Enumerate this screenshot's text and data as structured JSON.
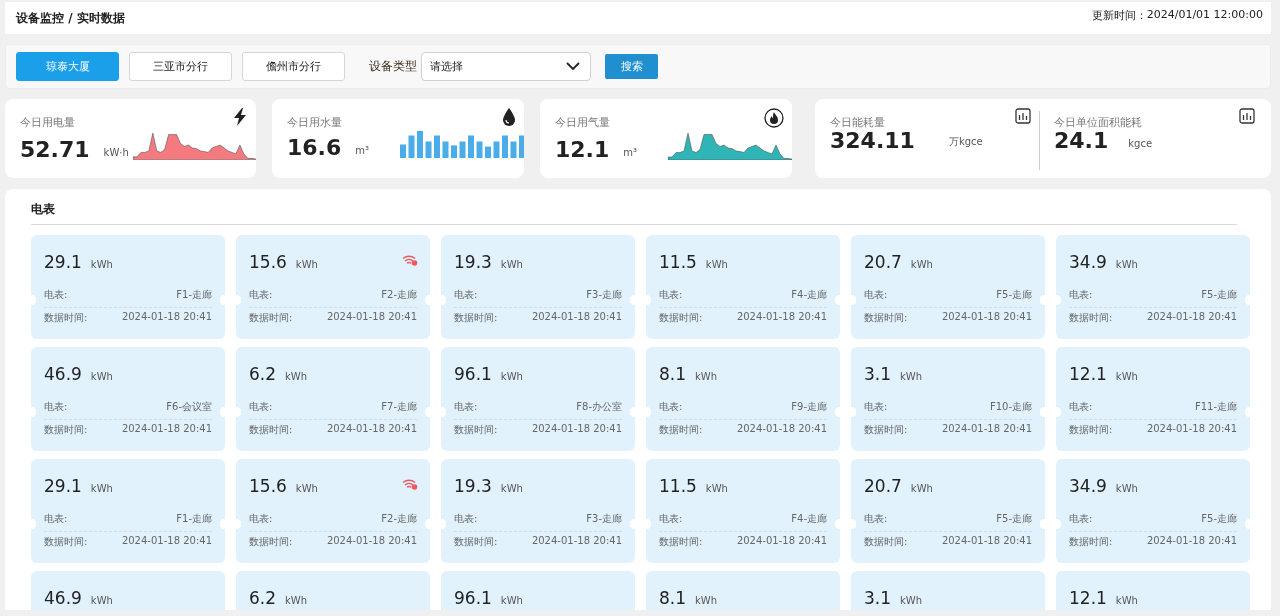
{
  "header": {
    "breadcrumb": "设备监控 / 实时数据",
    "update_label": "更新时间：",
    "update_time": "2024/01/01 12:00:00"
  },
  "filters": {
    "sites": [
      {
        "label": "琼泰大厦",
        "selected": true
      },
      {
        "label": "三亚市分行",
        "selected": false
      },
      {
        "label": "儋州市分行",
        "selected": false
      }
    ],
    "device_type_label": "设备类型",
    "device_type": {
      "placeholder": "请选择"
    },
    "search_button": "搜索"
  },
  "stats": [
    {
      "title": "今日用电量",
      "value": "52.71",
      "unit": "kW·h",
      "kind": "power",
      "color": "#f47a80"
    },
    {
      "title": "今日用水量",
      "value": "16.6",
      "unit": "m³",
      "kind": "water",
      "color": "#4aade8"
    },
    {
      "title": "今日用气量",
      "value": "12.1",
      "unit": "m³",
      "kind": "gas",
      "color": "#2fb5b5"
    }
  ],
  "energy": [
    {
      "title": "今日能耗量",
      "value": "324.11",
      "unit": "万kgce"
    },
    {
      "title": "今日单位面积能耗",
      "value": "24.1",
      "unit": "kgce"
    }
  ],
  "meters": {
    "title": "电表",
    "cards": [
      {
        "value": "29.1",
        "unit": "kWh",
        "offline": false,
        "meter_label": "电表:",
        "meter": "F1-走廊",
        "time_label": "数据时间:",
        "time": "2024-01-18 20:41"
      },
      {
        "value": "15.6",
        "unit": "kWh",
        "offline": true,
        "meter_label": "电表:",
        "meter": "F2-走廊",
        "time_label": "数据时间:",
        "time": "2024-01-18 20:41"
      },
      {
        "value": "19.3",
        "unit": "kWh",
        "offline": false,
        "meter_label": "电表:",
        "meter": "F3-走廊",
        "time_label": "数据时间:",
        "time": "2024-01-18 20:41"
      },
      {
        "value": "11.5",
        "unit": "kWh",
        "offline": false,
        "meter_label": "电表:",
        "meter": "F4-走廊",
        "time_label": "数据时间:",
        "time": "2024-01-18 20:41"
      },
      {
        "value": "20.7",
        "unit": "kWh",
        "offline": false,
        "meter_label": "电表:",
        "meter": "F5-走廊",
        "time_label": "数据时间:",
        "time": "2024-01-18 20:41"
      },
      {
        "value": "34.9",
        "unit": "kWh",
        "offline": false,
        "meter_label": "电表:",
        "meter": "F5-走廊",
        "time_label": "数据时间:",
        "time": "2024-01-18 20:41"
      },
      {
        "value": "46.9",
        "unit": "kWh",
        "offline": false,
        "meter_label": "电表:",
        "meter": "F6-会议室",
        "time_label": "数据时间:",
        "time": "2024-01-18 20:41"
      },
      {
        "value": "6.2",
        "unit": "kWh",
        "offline": false,
        "meter_label": "电表:",
        "meter": "F7-走廊",
        "time_label": "数据时间:",
        "time": "2024-01-18 20:41"
      },
      {
        "value": "96.1",
        "unit": "kWh",
        "offline": false,
        "meter_label": "电表:",
        "meter": "F8-办公室",
        "time_label": "数据时间:",
        "time": "2024-01-18 20:41"
      },
      {
        "value": "8.1",
        "unit": "kWh",
        "offline": false,
        "meter_label": "电表:",
        "meter": "F9-走廊",
        "time_label": "数据时间:",
        "time": "2024-01-18 20:41"
      },
      {
        "value": "3.1",
        "unit": "kWh",
        "offline": false,
        "meter_label": "电表:",
        "meter": "F10-走廊",
        "time_label": "数据时间:",
        "time": "2024-01-18 20:41"
      },
      {
        "value": "12.1",
        "unit": "kWh",
        "offline": false,
        "meter_label": "电表:",
        "meter": "F11-走廊",
        "time_label": "数据时间:",
        "time": "2024-01-18 20:41"
      },
      {
        "value": "29.1",
        "unit": "kWh",
        "offline": false,
        "meter_label": "电表:",
        "meter": "F1-走廊",
        "time_label": "数据时间:",
        "time": "2024-01-18 20:41"
      },
      {
        "value": "15.6",
        "unit": "kWh",
        "offline": true,
        "meter_label": "电表:",
        "meter": "F2-走廊",
        "time_label": "数据时间:",
        "time": "2024-01-18 20:41"
      },
      {
        "value": "19.3",
        "unit": "kWh",
        "offline": false,
        "meter_label": "电表:",
        "meter": "F3-走廊",
        "time_label": "数据时间:",
        "time": "2024-01-18 20:41"
      },
      {
        "value": "11.5",
        "unit": "kWh",
        "offline": false,
        "meter_label": "电表:",
        "meter": "F4-走廊",
        "time_label": "数据时间:",
        "time": "2024-01-18 20:41"
      },
      {
        "value": "20.7",
        "unit": "kWh",
        "offline": false,
        "meter_label": "电表:",
        "meter": "F5-走廊",
        "time_label": "数据时间:",
        "time": "2024-01-18 20:41"
      },
      {
        "value": "34.9",
        "unit": "kWh",
        "offline": false,
        "meter_label": "电表:",
        "meter": "F5-走廊",
        "time_label": "数据时间:",
        "time": "2024-01-18 20:41"
      },
      {
        "value": "46.9",
        "unit": "kWh",
        "offline": false
      },
      {
        "value": "6.2",
        "unit": "kWh",
        "offline": false
      },
      {
        "value": "96.1",
        "unit": "kWh",
        "offline": false
      },
      {
        "value": "8.1",
        "unit": "kWh",
        "offline": false
      },
      {
        "value": "3.1",
        "unit": "kWh",
        "offline": false
      },
      {
        "value": "12.1",
        "unit": "kWh",
        "offline": false
      }
    ]
  }
}
